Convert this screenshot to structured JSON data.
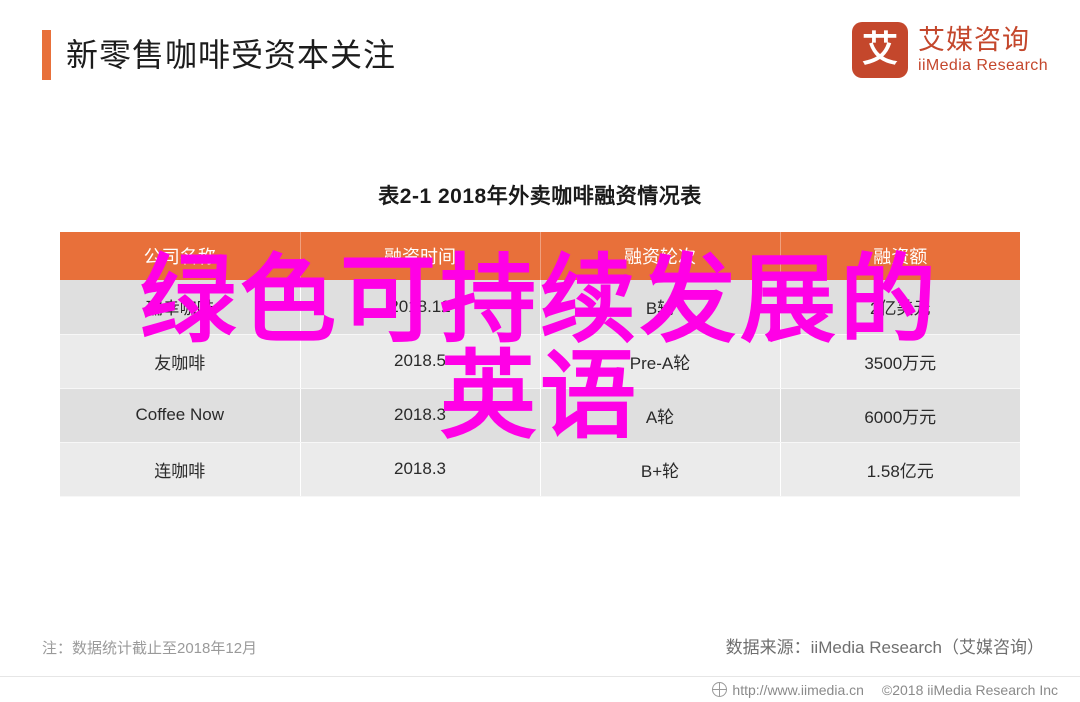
{
  "header": {
    "title": "新零售咖啡受资本关注",
    "accent_color": "#e8703a",
    "logo": {
      "mark": "艾",
      "name_cn": "艾媒咨询",
      "name_en": "iiMedia Research",
      "color": "#c4472c"
    }
  },
  "table": {
    "title": "表2-1 2018年外卖咖啡融资情况表",
    "header_color": "#e8703a",
    "columns": [
      "公司名称",
      "融资时间",
      "融资轮次",
      "融资额"
    ],
    "rows": [
      {
        "company": "瑞幸咖啡",
        "date": "2018.12",
        "round": "B轮",
        "amount": "2亿美元"
      },
      {
        "company": "友咖啡",
        "date": "2018.5",
        "round": "Pre-A轮",
        "amount": "3500万元"
      },
      {
        "company": "Coffee Now",
        "date": "2018.3",
        "round": "A轮",
        "amount": "6000万元"
      },
      {
        "company": "连咖啡",
        "date": "2018.3",
        "round": "B+轮",
        "amount": "1.58亿元"
      }
    ]
  },
  "notes": {
    "left": "注：数据统计截止至2018年12月",
    "right": "数据来源：iiMedia Research（艾媒咨询）"
  },
  "bottom_bar": {
    "url": "http://www.iimedia.cn",
    "copyright": "©2018  iiMedia Research Inc"
  },
  "overlay": {
    "line1": "绿色可持续发展的",
    "line2": "英语",
    "color": "#ff00e6"
  }
}
